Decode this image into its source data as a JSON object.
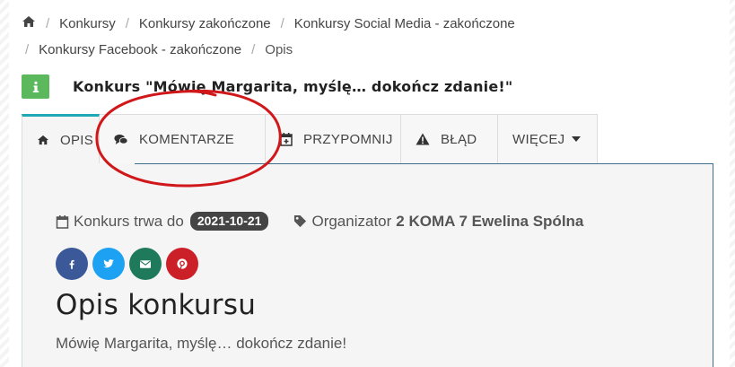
{
  "breadcrumb": {
    "items": [
      "Konkursy",
      "Konkursy zakończone",
      "Konkursy Social Media - zakończone",
      "Konkursy Facebook - zakończone",
      "Opis"
    ],
    "separator": "/",
    "home_icon": "home-icon"
  },
  "title": {
    "icon": "info-icon",
    "text": "Konkurs \"Mówię Margarita, myślę… dokończ zdanie!\""
  },
  "tabs": [
    {
      "label": "OPIS",
      "icon": "home-icon",
      "active": true
    },
    {
      "label": "KOMENTARZE",
      "icon": "comments-icon",
      "active": false
    },
    {
      "label": "PRZYPOMNIJ",
      "icon": "calendar-plus-icon",
      "active": false
    },
    {
      "label": "BŁĄD",
      "icon": "warning-icon",
      "active": false
    },
    {
      "label": "WIĘCEJ",
      "icon": "caret-down-icon",
      "active": false
    }
  ],
  "meta": {
    "duration_label": "Konkurs trwa do",
    "end_date": "2021-10-21",
    "organizer_label": "Organizator",
    "organizer_name": "2 KOMA 7 Ewelina Spólna"
  },
  "share": [
    {
      "network": "facebook",
      "icon": "facebook-icon",
      "color": "#3b5998"
    },
    {
      "network": "twitter",
      "icon": "twitter-icon",
      "color": "#1da1f2"
    },
    {
      "network": "email",
      "icon": "envelope-icon",
      "color": "#1f7a5c"
    },
    {
      "network": "pinterest",
      "icon": "pinterest-icon",
      "color": "#cb2027"
    }
  ],
  "section": {
    "heading": "Opis konkursu",
    "description": "Mówię Margarita, myślę… dokończ zdanie!"
  },
  "colors": {
    "accent_tab": "#1fa8b5",
    "info_badge": "#5cb85c",
    "annotation": "#d0181b"
  }
}
